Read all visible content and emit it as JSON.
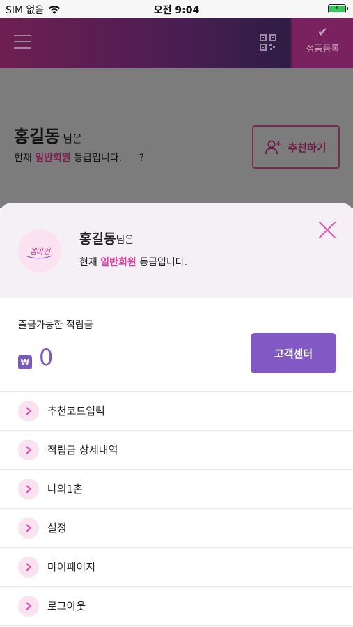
{
  "status_bar": {
    "carrier": "SIM 없음",
    "time": "오전 9:04"
  },
  "header": {
    "register_label": "정품등록"
  },
  "background": {
    "name": "홍길동",
    "name_suffix": "님은",
    "grade_prefix": "현재",
    "grade": "일반회원",
    "grade_suffix": "등급입니다.",
    "question": "?",
    "recommend_label": "추천하기"
  },
  "sheet": {
    "avatar_text": "엠마인",
    "name": "홍길동",
    "name_suffix": "님은",
    "grade_prefix": "현재",
    "grade": "일반회원",
    "grade_suffix": "등급입니다.",
    "balance_label": "출금가능한 적립금",
    "currency": "₩",
    "balance_value": "0",
    "cs_button": "고객센터",
    "menu": [
      {
        "label": "추천코드입력"
      },
      {
        "label": "적립금 상세내역"
      },
      {
        "label": "나의1촌"
      },
      {
        "label": "설정"
      },
      {
        "label": "마이페이지"
      },
      {
        "label": "로그아웃"
      }
    ]
  },
  "colors": {
    "accent": "#e03c9e",
    "purple": "#8259c4",
    "header": "#6e1f52"
  }
}
